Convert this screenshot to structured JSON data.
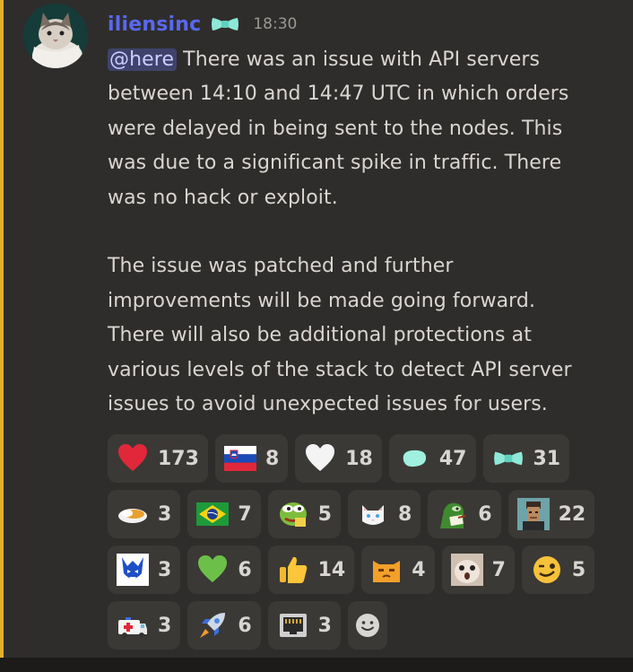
{
  "message": {
    "username": "iliensinc",
    "timestamp": "18:30",
    "avatar_icon": "cat-avatar-icon",
    "badge_icon": "bowtie-badge-icon",
    "mention": "@here",
    "paragraph1_lines": [
      " There was an issue with API servers",
      "between 14:10 and 14:47 UTC in which orders",
      "were delayed in being sent to the nodes. This",
      "was due to a significant spike in traffic. There",
      "was no hack or exploit."
    ],
    "paragraph2_lines": [
      "The issue was patched and further",
      "improvements will be made going forward.",
      "There will also be additional protections at",
      "various levels of the stack to detect API server",
      "issues to avoid unexpected issues for users."
    ]
  },
  "reactions": [
    {
      "icon": "red-heart-icon",
      "count": "173"
    },
    {
      "icon": "slovenia-flag-icon",
      "count": "8"
    },
    {
      "icon": "white-heart-icon",
      "count": "18"
    },
    {
      "icon": "teal-blob-icon",
      "count": "47"
    },
    {
      "icon": "teal-bowtie-icon",
      "count": "31"
    },
    {
      "icon": "curry-bowl-icon",
      "count": "3"
    },
    {
      "icon": "brazil-flag-icon",
      "count": "7"
    },
    {
      "icon": "pepe-frog-icon",
      "count": "5"
    },
    {
      "icon": "white-cat-icon",
      "count": "8"
    },
    {
      "icon": "pepe-note-icon",
      "count": "6"
    },
    {
      "icon": "pixel-avatar-icon",
      "count": "22"
    },
    {
      "icon": "blue-wolf-icon",
      "count": "3"
    },
    {
      "icon": "green-heart-icon",
      "count": "6"
    },
    {
      "icon": "thumbs-up-icon",
      "count": "14"
    },
    {
      "icon": "orange-cat-icon",
      "count": "4"
    },
    {
      "icon": "hamster-icon",
      "count": "7"
    },
    {
      "icon": "winking-face-icon",
      "count": "5"
    },
    {
      "icon": "ambulance-icon",
      "count": "3"
    },
    {
      "icon": "rocket-icon",
      "count": "6"
    },
    {
      "icon": "ethernet-port-icon",
      "count": "3"
    }
  ],
  "add_reaction_icon": "add-reaction-smiley-icon",
  "colors": {
    "background": "#2f2d2b",
    "accent_border": "#e0b02c",
    "username": "#5968f0",
    "mention_bg": "#3f436c",
    "reaction_bg": "#3b3935"
  }
}
